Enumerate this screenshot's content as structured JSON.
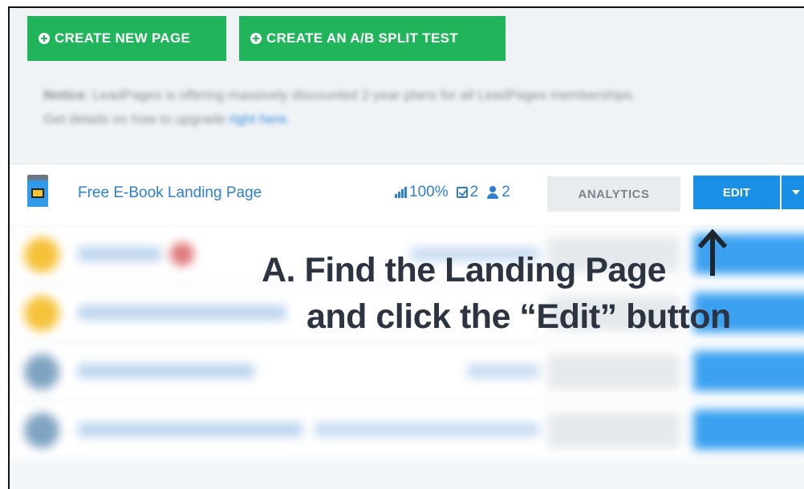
{
  "toolbar": {
    "create_page_label": "CREATE NEW PAGE",
    "create_split_label": "CREATE AN A/B SPLIT TEST"
  },
  "notice": {
    "bold": "Notice",
    "text": "LeadPages is offering massively discounted 2-year plans for all LeadPages memberships.",
    "line2": "Get details on how to upgrade",
    "link": "right here."
  },
  "featured_page": {
    "name": "Free E-Book Landing Page",
    "conversion": "100%",
    "tasks": "2",
    "users": "2",
    "analytics_label": "ANALYTICS",
    "edit_label": "EDIT"
  },
  "annotation": {
    "line1": "A. Find the Landing Page",
    "line2": "and click the “Edit” button"
  },
  "colors": {
    "green": "#21b55b",
    "blue": "#1a8fe6",
    "link": "#2e7fd0"
  },
  "icons": [
    "plus-circle-icon",
    "bar-chart-icon",
    "check-square-icon",
    "user-icon",
    "caret-down-icon",
    "arrow-up-icon"
  ]
}
